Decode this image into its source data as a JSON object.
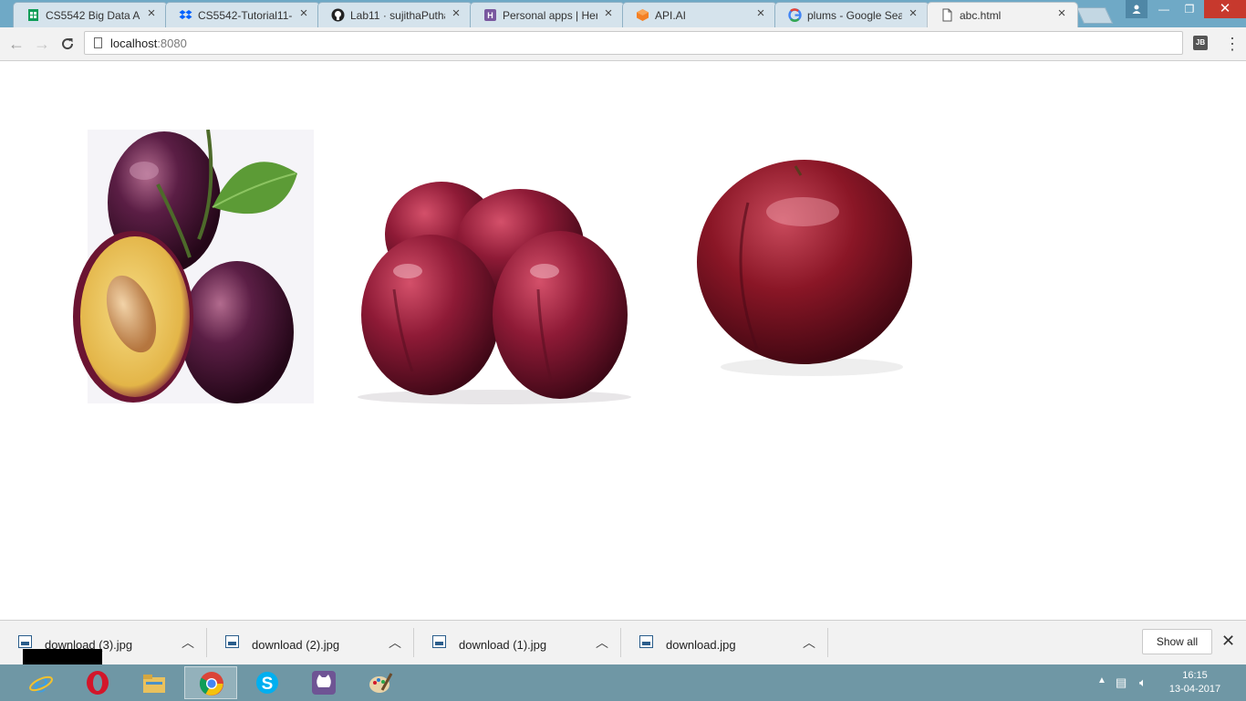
{
  "tabs": [
    {
      "label": "CS5542 Big Data Ar",
      "icon": "sheets-icon"
    },
    {
      "label": "CS5542-Tutorial11-",
      "icon": "dropbox-icon"
    },
    {
      "label": "Lab11 · sujithaPutha",
      "icon": "github-icon"
    },
    {
      "label": "Personal apps | Herc",
      "icon": "heroku-icon"
    },
    {
      "label": "API.AI",
      "icon": "apiai-icon"
    },
    {
      "label": "plums - Google Sea",
      "icon": "google-icon"
    },
    {
      "label": "abc.html",
      "icon": "page-icon"
    }
  ],
  "address_bar": {
    "host": "localhost",
    "port": ":8080"
  },
  "extension": {
    "label": "JB"
  },
  "images": [
    {
      "alt": "plums with halved plum and leaf"
    },
    {
      "alt": "three red plums"
    },
    {
      "alt": "single red plum"
    }
  ],
  "downloads": [
    {
      "name": "download (3).jpg"
    },
    {
      "name": "download (2).jpg"
    },
    {
      "name": "download (1).jpg"
    },
    {
      "name": "download.jpg"
    }
  ],
  "shelf": {
    "show_all": "Show all"
  },
  "taskbar": {
    "apps": [
      "ie-icon",
      "opera-icon",
      "file-explorer-icon",
      "chrome-icon",
      "skype-icon",
      "github-desktop-icon",
      "paint-icon"
    ],
    "time": "16:15",
    "date": "13-04-2017"
  },
  "colors": {
    "plum_dark": "#5a0f1f",
    "plum_red": "#8e1a2c",
    "taskbar": "#6f97a5"
  }
}
